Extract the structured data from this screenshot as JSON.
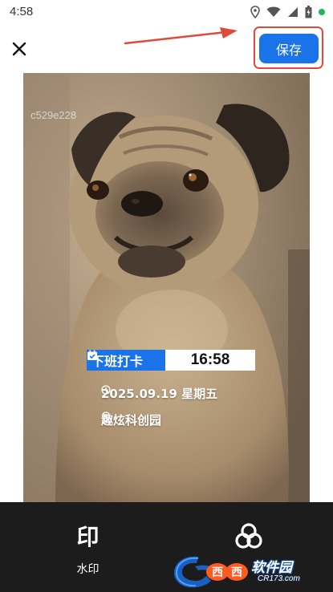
{
  "status_bar": {
    "time": "4:58",
    "icons": [
      "location-icon",
      "wifi-icon",
      "signal-icon",
      "battery-icon",
      "notification-dot-icon"
    ]
  },
  "header": {
    "close_icon": "close-icon",
    "save_label": "保存",
    "annotation_color": "#e04a3a"
  },
  "photo": {
    "watermark_id": "c529e228",
    "stamp": {
      "badge_label": "下班打卡",
      "time": "16:58",
      "date": "2025.09.19 星期五",
      "location": "趣炫科创园"
    }
  },
  "toolbar": {
    "watermark_glyph": "印",
    "watermark_label": "水印",
    "filter_icon": "filter-icon"
  },
  "site_logo": {
    "name": "软件园",
    "url": "CR173.com"
  },
  "colors": {
    "accent": "#1a73e8",
    "bottom_bar": "#1c1c1c"
  }
}
